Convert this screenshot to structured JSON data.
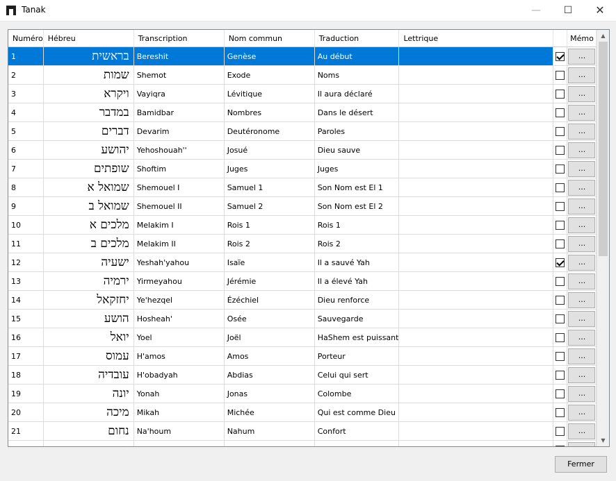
{
  "window": {
    "title": "Tanak",
    "icon": "app-icon",
    "controls": {
      "minimize": "—",
      "maximize": "☐",
      "close": "✕"
    }
  },
  "grid": {
    "columns": {
      "num": "Numéro",
      "heb": "Hébreu",
      "trans": "Transcription",
      "common": "Nom commun",
      "trad": "Traduction",
      "lettrique": "Lettrique",
      "check": "",
      "memo": "Mémo"
    },
    "memo_label": "...",
    "selected_row": 1,
    "rows": [
      {
        "num": "1",
        "heb": "בראשית",
        "trans": "Bereshit",
        "common": "Genèse",
        "trad": "Au début",
        "lettrique": "",
        "checked": true
      },
      {
        "num": "2",
        "heb": "שמות",
        "trans": "Shemot",
        "common": "Exode",
        "trad": "Noms",
        "lettrique": "",
        "checked": false
      },
      {
        "num": "3",
        "heb": "ויקרא",
        "trans": "Vayiqra",
        "common": "Lévitique",
        "trad": "Il aura déclaré",
        "lettrique": "",
        "checked": false
      },
      {
        "num": "4",
        "heb": "במדבר",
        "trans": "Bamidbar",
        "common": "Nombres",
        "trad": "Dans le désert",
        "lettrique": "",
        "checked": false
      },
      {
        "num": "5",
        "heb": "דברים",
        "trans": "Devarim",
        "common": "Deutéronome",
        "trad": "Paroles",
        "lettrique": "",
        "checked": false
      },
      {
        "num": "6",
        "heb": "יהושע",
        "trans": "Yehoshouah''",
        "common": "Josué",
        "trad": "Dieu sauve",
        "lettrique": "",
        "checked": false
      },
      {
        "num": "7",
        "heb": "שופתים",
        "trans": "Shoftim",
        "common": "Juges",
        "trad": "Juges",
        "lettrique": "",
        "checked": false
      },
      {
        "num": "8",
        "heb": "שמואל א",
        "trans": "Shemouel I",
        "common": "Samuel 1",
        "trad": "Son Nom est El 1",
        "lettrique": "",
        "checked": false
      },
      {
        "num": "9",
        "heb": "שמואל ב",
        "trans": "Shemouel II",
        "common": "Samuel 2",
        "trad": "Son Nom est El 2",
        "lettrique": "",
        "checked": false
      },
      {
        "num": "10",
        "heb": "מלכים א",
        "trans": "Melakim I",
        "common": "Rois 1",
        "trad": "Rois 1",
        "lettrique": "",
        "checked": false
      },
      {
        "num": "11",
        "heb": "מלכים ב",
        "trans": "Melakim II",
        "common": "Rois 2",
        "trad": "Rois 2",
        "lettrique": "",
        "checked": false
      },
      {
        "num": "12",
        "heb": "ישעיה",
        "trans": "Yeshah'yahou",
        "common": "Isaïe",
        "trad": "Il a sauvé Yah",
        "lettrique": "",
        "checked": true
      },
      {
        "num": "13",
        "heb": "ירמיה",
        "trans": "Yirmeyahou",
        "common": "Jérémie",
        "trad": "Il a élevé Yah",
        "lettrique": "",
        "checked": false
      },
      {
        "num": "14",
        "heb": "יחזקאל",
        "trans": "Ye'hezqel",
        "common": "Ézéchiel",
        "trad": "Dieu renforce",
        "lettrique": "",
        "checked": false
      },
      {
        "num": "15",
        "heb": "הושע",
        "trans": "Hosheah'",
        "common": "Osée",
        "trad": "Sauvegarde",
        "lettrique": "",
        "checked": false
      },
      {
        "num": "16",
        "heb": "יואל",
        "trans": "Yoel",
        "common": "Joël",
        "trad": "HaShem est puissant",
        "lettrique": "",
        "checked": false
      },
      {
        "num": "17",
        "heb": "עמוס",
        "trans": "H'amos",
        "common": "Amos",
        "trad": "Porteur",
        "lettrique": "",
        "checked": false
      },
      {
        "num": "18",
        "heb": "עובדיה",
        "trans": "H'obadyah",
        "common": "Abdias",
        "trad": "Celui qui sert",
        "lettrique": "",
        "checked": false
      },
      {
        "num": "19",
        "heb": "יונה",
        "trans": "Yonah",
        "common": "Jonas",
        "trad": "Colombe",
        "lettrique": "",
        "checked": false
      },
      {
        "num": "20",
        "heb": "מיכה",
        "trans": "Mikah",
        "common": "Michée",
        "trad": "Qui est comme Dieu",
        "lettrique": "",
        "checked": false
      },
      {
        "num": "21",
        "heb": "נחום",
        "trans": "Na'houm",
        "common": "Nahum",
        "trad": "Confort",
        "lettrique": "",
        "checked": false
      },
      {
        "num": "",
        "heb": "חבקוק",
        "trans": "",
        "common": "",
        "trad": "",
        "lettrique": "",
        "checked": false
      }
    ]
  },
  "scrollbar": {
    "up": "▲",
    "down": "▼"
  },
  "footer": {
    "close_label": "Fermer"
  },
  "colors": {
    "selection": "#0078d7",
    "selection_text": "#ffffff"
  }
}
